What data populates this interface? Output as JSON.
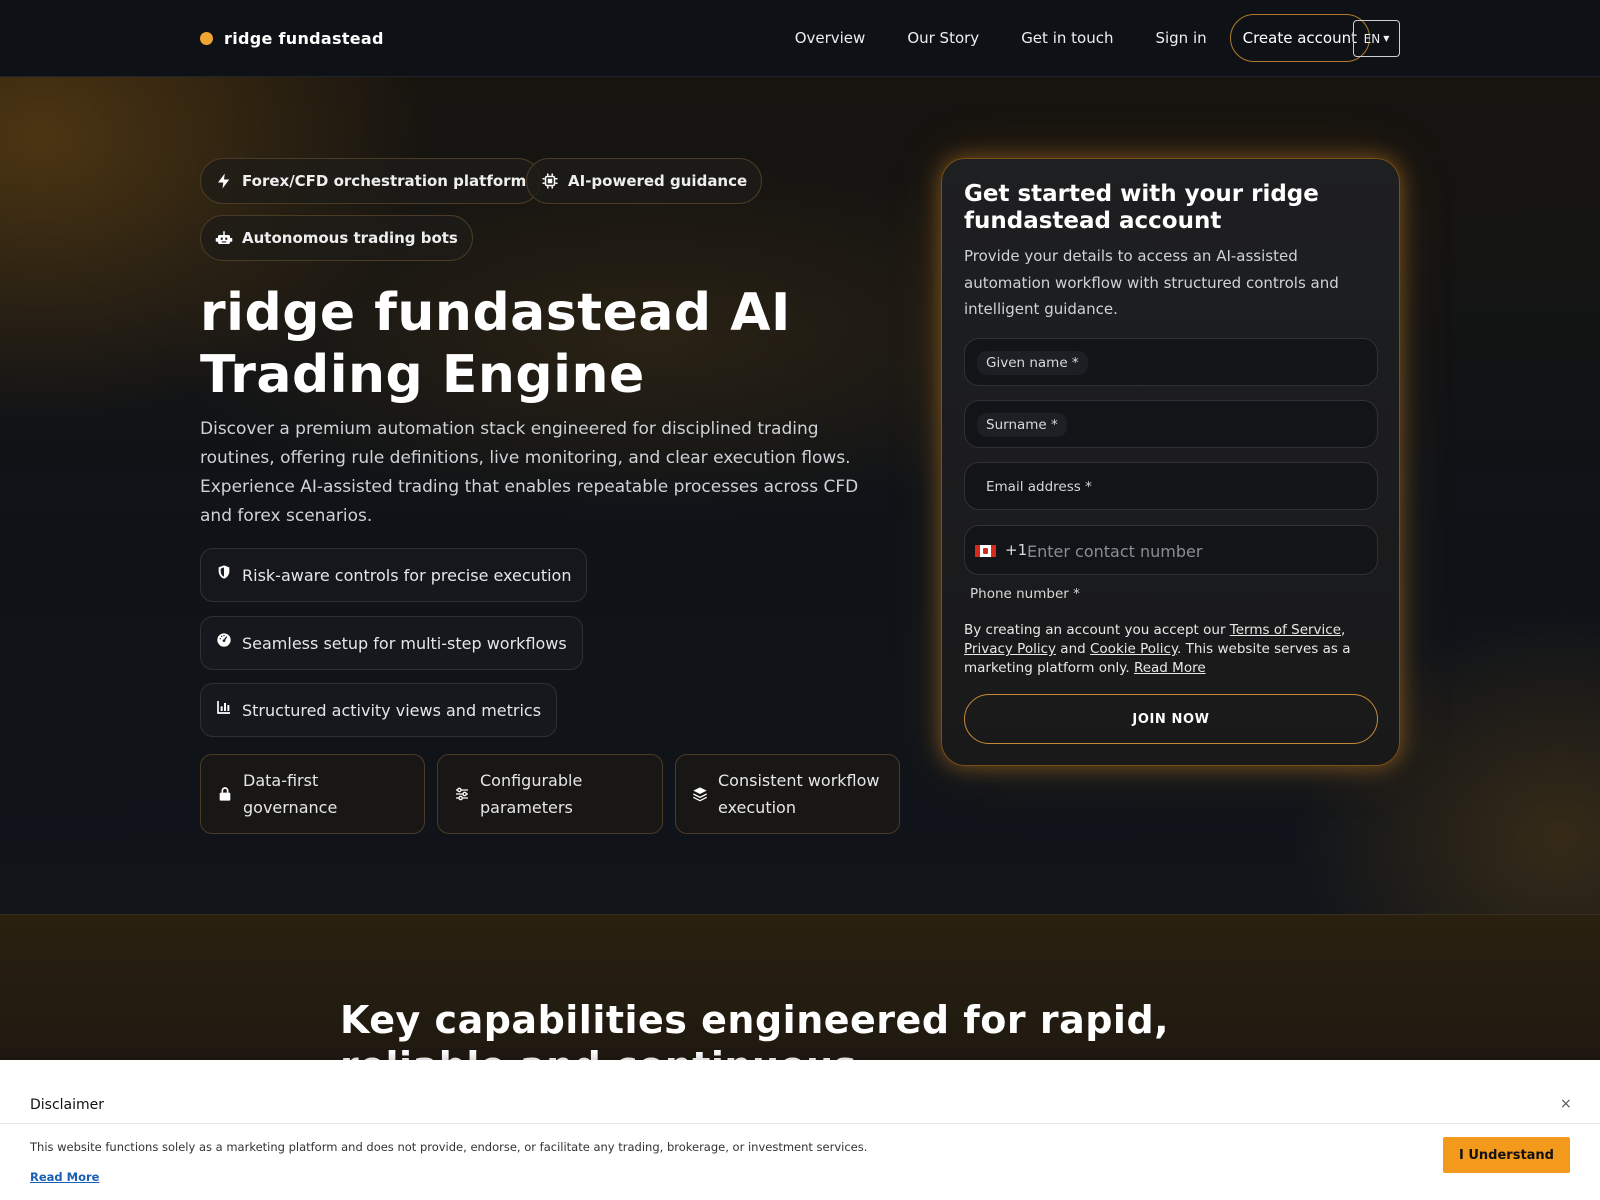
{
  "nav": {
    "brand": "ridge fundastead",
    "links": [
      "Overview",
      "Our Story",
      "Get in touch",
      "Sign in"
    ],
    "cta": "Create account",
    "language": "EN"
  },
  "hero": {
    "badges": [
      {
        "label": "Forex/CFD orchestration platform",
        "icon": "bolt-icon"
      },
      {
        "label": "AI-powered guidance",
        "icon": "chip-icon"
      },
      {
        "label": "Autonomous trading bots",
        "icon": "robot-icon"
      }
    ],
    "title": "ridge fundastead AI Trading Engine",
    "description": "Discover a premium automation stack engineered for disciplined trading routines, offering rule definitions, live monitoring, and clear execution flows. Experience AI-assisted trading that enables repeatable processes across CFD and forex scenarios.",
    "features": [
      {
        "label": "Risk-aware controls for precise execution",
        "icon": "shield-icon"
      },
      {
        "label": "Seamless setup for multi-step workflows",
        "icon": "gauge-icon"
      },
      {
        "label": "Structured activity views and metrics",
        "icon": "bar-chart-icon"
      }
    ],
    "cards": [
      {
        "label": "Data-first governance",
        "icon": "lock-icon"
      },
      {
        "label": "Configurable parameters",
        "icon": "sliders-icon"
      },
      {
        "label": "Consistent workflow execution",
        "icon": "layers-icon"
      }
    ]
  },
  "signup": {
    "title": "Get started with your ridge fundastead account",
    "subtitle": "Provide your details to access an AI-assisted automation workflow with structured controls and intelligent guidance.",
    "given_name_label": "Given name *",
    "surname_label": "Surname *",
    "email_label": "Email address *",
    "phone_code": "+1",
    "phone_placeholder": "Enter contact number",
    "phone_label": "Phone number *",
    "legal_prefix": "By creating an account you accept our ",
    "terms_link": "Terms of Service",
    "comma": ",",
    "privacy_link": "Privacy Policy",
    "and_text": " and ",
    "cookie_link": "Cookie Policy",
    "legal_suffix": ". This website serves as a marketing platform only. ",
    "read_more": "Read More",
    "join_button": "JOIN NOW"
  },
  "capabilities": {
    "heading": "Key capabilities engineered for rapid, reliable and continuous"
  },
  "disclaimer": {
    "title": "Disclaimer",
    "close": "×",
    "text": "This website functions solely as a marketing platform and does not provide, endorse, or facilitate any trading, brokerage, or investment services.",
    "read_more": "Read More",
    "button": "I Understand"
  },
  "colors": {
    "accent": "#f0a432",
    "background": "#0f1216",
    "disclaimer_button": "#f39a1d"
  }
}
